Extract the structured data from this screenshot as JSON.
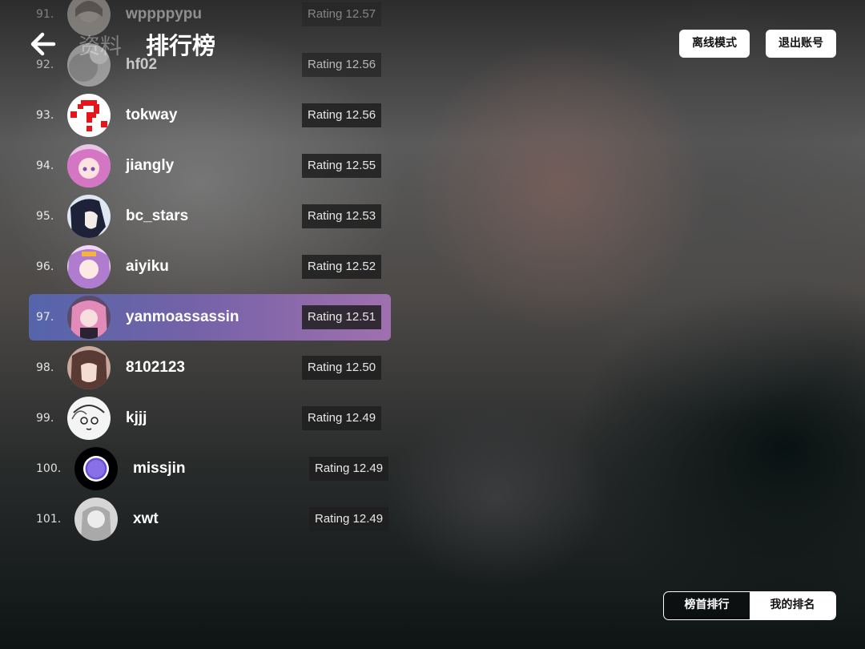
{
  "header": {
    "prev_tab": "资料",
    "title": "排行榜",
    "offline_mode": "离线模式",
    "logout": "退出账号"
  },
  "segmented": {
    "top_rank": "榜首排行",
    "my_rank": "我的排名",
    "selected": "我的排名"
  },
  "colors": {
    "highlight_start": "#5565aa",
    "highlight_end": "#a070ae"
  },
  "rows": [
    {
      "rank": "91.",
      "name": "wppppypu",
      "rating": "Rating 12.57",
      "avatar": "anime-girl-avatar"
    },
    {
      "rank": "92.",
      "name": "hf02",
      "rating": "Rating 12.56",
      "avatar": "grey-avatar"
    },
    {
      "rank": "93.",
      "name": "tokway",
      "rating": "Rating 12.56",
      "avatar": "red-question-mark-avatar"
    },
    {
      "rank": "94.",
      "name": "jiangly",
      "rating": "Rating 12.55",
      "avatar": "pink-hair-anime-avatar"
    },
    {
      "rank": "95.",
      "name": "bc_stars",
      "rating": "Rating 12.53",
      "avatar": "dark-hair-anime-avatar"
    },
    {
      "rank": "96.",
      "name": "aiyiku",
      "rating": "Rating 12.52",
      "avatar": "anime-girl-avatar"
    },
    {
      "rank": "97.",
      "name": "yanmoassassin",
      "rating": "Rating 12.51",
      "avatar": "pink-hair-anime-avatar"
    },
    {
      "rank": "98.",
      "name": "8102123",
      "rating": "Rating 12.50",
      "avatar": "brown-hair-anime-avatar"
    },
    {
      "rank": "99.",
      "name": "kjjj",
      "rating": "Rating 12.49",
      "avatar": "manga-sketch-avatar"
    },
    {
      "rank": "100.",
      "name": "missjin",
      "rating": "Rating 12.49",
      "avatar": "purple-orb-avatar"
    },
    {
      "rank": "101.",
      "name": "xwt",
      "rating": "Rating 12.49",
      "avatar": "pale-grey-avatar"
    }
  ]
}
